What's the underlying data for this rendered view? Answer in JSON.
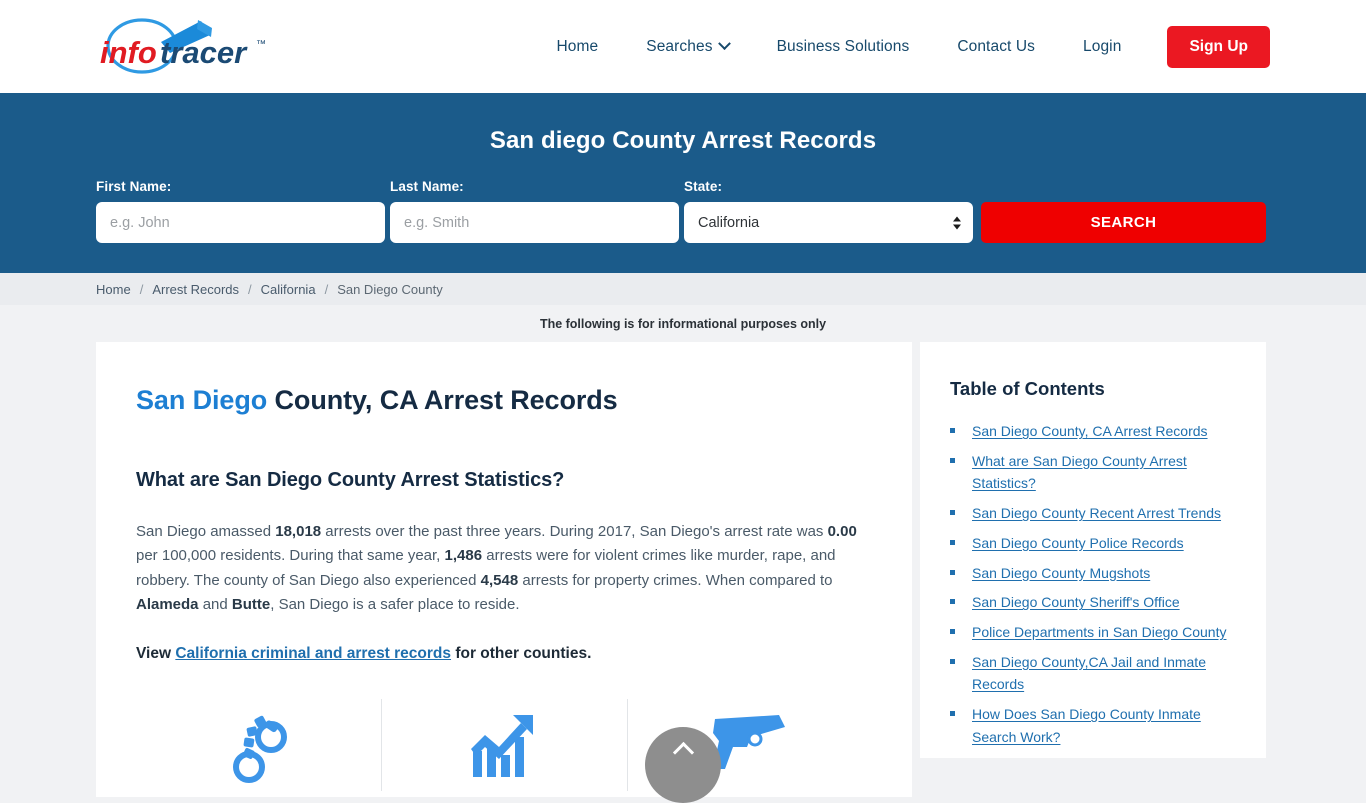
{
  "header": {
    "logo": {
      "part1": "info",
      "part2": "tracer",
      "tm": "™",
      "name": "infotracer-logo"
    },
    "nav": [
      {
        "label": "Home",
        "name": "nav-home"
      },
      {
        "label": "Searches",
        "name": "nav-searches",
        "has_chevron": true
      },
      {
        "label": "Business Solutions",
        "name": "nav-business-solutions"
      },
      {
        "label": "Contact Us",
        "name": "nav-contact-us"
      },
      {
        "label": "Login",
        "name": "nav-login"
      }
    ],
    "signup_label": "Sign Up",
    "signup_color": "#eb1822"
  },
  "banner": {
    "title": "San diego County Arrest Records",
    "bg_color": "#1b5b8a",
    "fields": {
      "first_name": {
        "label": "First Name:",
        "placeholder": "e.g. John",
        "value": ""
      },
      "last_name": {
        "label": "Last Name:",
        "placeholder": "e.g. Smith",
        "value": ""
      },
      "state": {
        "label": "State:",
        "value": "California",
        "options": [
          "California"
        ]
      }
    },
    "search_label": "SEARCH",
    "search_color": "#ef0000"
  },
  "breadcrumb": {
    "separator": "/",
    "items": [
      {
        "label": "Home"
      },
      {
        "label": "Arrest Records"
      },
      {
        "label": "California"
      },
      {
        "label": "San Diego County",
        "current": true
      }
    ]
  },
  "disclaimer": "The following is for informational purposes only",
  "main": {
    "title_highlight": "San Diego",
    "title_rest": " County, CA Arrest Records",
    "subtitle": "What are San Diego County Arrest Statistics?",
    "paragraph": {
      "s1": "San Diego amassed ",
      "b1": "18,018",
      "s2": " arrests over the past three years. During 2017, San Diego's arrest rate was ",
      "b2": "0.00",
      "s3": " per 100,000 residents. During that same year, ",
      "b3": "1,486",
      "s4": " arrests were for violent crimes like murder, rape, and robbery. The county of San Diego also experienced ",
      "b4": "4,548",
      "s5": " arrests for property crimes. When compared to ",
      "b5": "Alameda",
      "s6": " and ",
      "b6": "Butte",
      "s7": ", San Diego is a safer place to reside."
    },
    "view_line": {
      "prefix": "View ",
      "link": "California criminal and arrest records",
      "suffix": " for other counties."
    },
    "icons": [
      {
        "name": "handcuffs-icon",
        "color": "#3d95e8"
      },
      {
        "name": "trending-up-chart-icon",
        "color": "#3d95e8"
      },
      {
        "name": "handgun-icon",
        "color": "#3d95e8"
      }
    ]
  },
  "sidebar": {
    "title": "Table of Contents",
    "items": [
      {
        "label": "San Diego County, CA Arrest Records"
      },
      {
        "label": "What are San Diego County Arrest Statistics?"
      },
      {
        "label": "San Diego County Recent Arrest Trends"
      },
      {
        "label": "San Diego County Police Records"
      },
      {
        "label": "San Diego County Mugshots"
      },
      {
        "label": "San Diego County Sheriff's Office"
      },
      {
        "label": "Police Departments in San Diego County"
      },
      {
        "label": "San Diego County,CA Jail and Inmate Records"
      },
      {
        "label": "How Does San Diego County Inmate Search Work?"
      }
    ],
    "link_color": "#1f6fae"
  },
  "scroll_top": {
    "name": "scroll-to-top-button",
    "color": "#8e8e8e"
  }
}
